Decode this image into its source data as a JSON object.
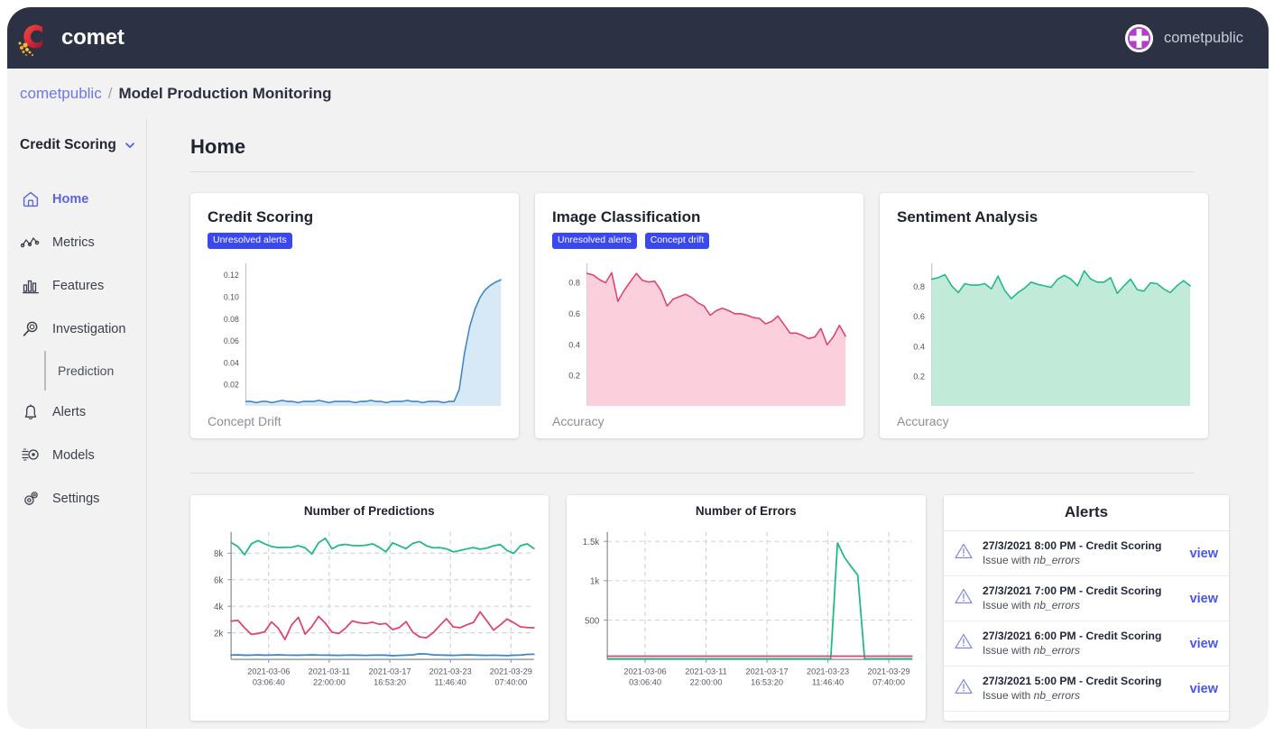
{
  "topbar": {
    "brand_name": "comet",
    "logo_icon": "comet-logo-icon",
    "user_name": "cometpublic",
    "avatar_icon": "user-avatar-icon"
  },
  "breadcrumb": {
    "workspace": "cometpublic",
    "separator": "/",
    "current": "Model Production Monitoring"
  },
  "sidebar": {
    "project": "Credit Scoring",
    "project_chevron": "chevron-down-icon",
    "items": [
      {
        "label": "Home",
        "icon": "home-icon",
        "active": true
      },
      {
        "label": "Metrics",
        "icon": "metrics-icon",
        "active": false
      },
      {
        "label": "Features",
        "icon": "features-bar-chart-icon",
        "active": false
      },
      {
        "label": "Investigation",
        "icon": "magnifier-icon",
        "active": false
      },
      {
        "label": "Alerts",
        "icon": "bell-icon",
        "active": false
      },
      {
        "label": "Models",
        "icon": "models-icon",
        "active": false
      },
      {
        "label": "Settings",
        "icon": "gear-icon",
        "active": false
      }
    ],
    "subitem": "Prediction"
  },
  "main": {
    "page_title": "Home"
  },
  "colors": {
    "badge_blue": "#3b48ee",
    "link_blue": "#4a55e8",
    "blue_line": "#3d85c6",
    "blue_fill": "#d7e8f7",
    "pink_line": "#e0436d",
    "pink_fill": "#fbd0dc",
    "green_line": "#1db98a",
    "green_fill": "#c2ead9",
    "topbar_bg": "#2c3244"
  },
  "cards": [
    {
      "title": "Credit Scoring",
      "badges": [
        "Unresolved alerts"
      ],
      "footer_label": "Concept Drift"
    },
    {
      "title": "Image Classification",
      "badges": [
        "Unresolved alerts",
        "Concept drift"
      ],
      "footer_label": "Accuracy"
    },
    {
      "title": "Sentiment Analysis",
      "badges": [],
      "footer_label": "Accuracy"
    }
  ],
  "panels": {
    "predictions_title": "Number of Predictions",
    "errors_title": "Number of Errors",
    "alerts_title": "Alerts"
  },
  "alerts": [
    {
      "title": "27/3/2021 8:00 PM - Credit Scoring",
      "sub_prefix": "Issue with ",
      "sub_metric": "nb_errors",
      "action": "view",
      "icon": "warning-triangle-icon"
    },
    {
      "title": "27/3/2021 7:00 PM - Credit Scoring",
      "sub_prefix": "Issue with ",
      "sub_metric": "nb_errors",
      "action": "view",
      "icon": "warning-triangle-icon"
    },
    {
      "title": "27/3/2021 6:00 PM - Credit Scoring",
      "sub_prefix": "Issue with ",
      "sub_metric": "nb_errors",
      "action": "view",
      "icon": "warning-triangle-icon"
    },
    {
      "title": "27/3/2021 5:00 PM - Credit Scoring",
      "sub_prefix": "Issue with ",
      "sub_metric": "nb_errors",
      "action": "view",
      "icon": "warning-triangle-icon"
    }
  ],
  "chart_data": [
    {
      "id": "credit_scoring_drift",
      "type": "area",
      "title": "Credit Scoring",
      "ylabel": "Concept Drift",
      "xlabel": "",
      "grid": false,
      "ylim": [
        0,
        0.13
      ],
      "yticks": [
        0.02,
        0.04,
        0.06,
        0.08,
        0.1,
        0.12
      ],
      "ytick_labels": [
        "0.02",
        "0.04",
        "0.06",
        "0.08",
        "0.10",
        "0.12"
      ],
      "series": [
        {
          "name": "Concept Drift",
          "color": "#3d85c6",
          "fill": "#d7e8f7",
          "values": [
            0.004,
            0.004,
            0.003,
            0.004,
            0.004,
            0.003,
            0.004,
            0.005,
            0.004,
            0.004,
            0.003,
            0.004,
            0.004,
            0.004,
            0.005,
            0.004,
            0.003,
            0.004,
            0.004,
            0.004,
            0.004,
            0.003,
            0.004,
            0.004,
            0.005,
            0.004,
            0.004,
            0.003,
            0.004,
            0.004,
            0.004,
            0.005,
            0.004,
            0.004,
            0.003,
            0.004,
            0.004,
            0.004,
            0.003,
            0.004,
            0.004,
            0.015,
            0.048,
            0.072,
            0.088,
            0.099,
            0.106,
            0.11,
            0.113,
            0.115
          ]
        }
      ]
    },
    {
      "id": "image_classification_accuracy",
      "type": "area",
      "title": "Image Classification",
      "ylabel": "Accuracy",
      "xlabel": "",
      "grid": false,
      "ylim": [
        0,
        0.92
      ],
      "yticks": [
        0.2,
        0.4,
        0.6,
        0.8
      ],
      "ytick_labels": [
        "0.2",
        "0.4",
        "0.6",
        "0.8"
      ],
      "series": [
        {
          "name": "Accuracy",
          "color": "#e0436d",
          "fill": "#fbd0dc",
          "values": [
            0.855,
            0.845,
            0.815,
            0.795,
            0.86,
            0.675,
            0.745,
            0.8,
            0.855,
            0.81,
            0.8,
            0.805,
            0.745,
            0.645,
            0.69,
            0.705,
            0.72,
            0.7,
            0.665,
            0.645,
            0.585,
            0.615,
            0.63,
            0.615,
            0.595,
            0.595,
            0.585,
            0.57,
            0.565,
            0.53,
            0.545,
            0.58,
            0.525,
            0.47,
            0.47,
            0.455,
            0.435,
            0.445,
            0.5,
            0.395,
            0.445,
            0.52,
            0.45
          ]
        }
      ]
    },
    {
      "id": "sentiment_analysis_accuracy",
      "type": "area",
      "title": "Sentiment Analysis",
      "ylabel": "Accuracy",
      "xlabel": "",
      "grid": false,
      "ylim": [
        0,
        0.95
      ],
      "yticks": [
        0.2,
        0.4,
        0.6,
        0.8
      ],
      "ytick_labels": [
        "0.2",
        "0.4",
        "0.6",
        "0.8"
      ],
      "series": [
        {
          "name": "Accuracy",
          "color": "#1db98a",
          "fill": "#c2ead9",
          "values": [
            0.845,
            0.855,
            0.875,
            0.8,
            0.755,
            0.815,
            0.805,
            0.805,
            0.815,
            0.78,
            0.865,
            0.77,
            0.715,
            0.755,
            0.785,
            0.825,
            0.81,
            0.8,
            0.79,
            0.845,
            0.87,
            0.845,
            0.8,
            0.9,
            0.845,
            0.825,
            0.825,
            0.855,
            0.75,
            0.8,
            0.845,
            0.775,
            0.765,
            0.82,
            0.815,
            0.78,
            0.755,
            0.8,
            0.835,
            0.8
          ]
        }
      ]
    },
    {
      "id": "number_of_predictions",
      "type": "line",
      "title": "Number of Predictions",
      "xlabel": "",
      "ylabel": "",
      "grid": true,
      "ylim": [
        0,
        9600
      ],
      "yticks": [
        2000,
        4000,
        6000,
        8000
      ],
      "ytick_labels": [
        "2k",
        "4k",
        "6k",
        "8k"
      ],
      "xtick_labels": [
        "2021-03-06\n03:06:40",
        "2021-03-11\n22:00:00",
        "2021-03-17\n16:53:20",
        "2021-03-23\n11:46:40",
        "2021-03-29\n07:40:00"
      ],
      "series": [
        {
          "name": "green",
          "color": "#1db98a",
          "values": [
            8800,
            8500,
            7880,
            8700,
            8950,
            8700,
            8500,
            8420,
            8430,
            8450,
            8560,
            8400,
            7930,
            8780,
            9120,
            8330,
            8600,
            8660,
            8580,
            8560,
            8600,
            8700,
            8450,
            8100,
            8780,
            8560,
            8340,
            8740,
            8870,
            8560,
            8400,
            8420,
            8330,
            8100,
            8200,
            8320,
            8420,
            8300,
            8380,
            8560,
            8650,
            8200,
            7980,
            8560,
            8700,
            8350
          ]
        },
        {
          "name": "pink",
          "color": "#e0436d",
          "values": [
            2880,
            2940,
            2380,
            1880,
            1950,
            2080,
            2820,
            2350,
            1500,
            2600,
            3170,
            1900,
            2470,
            3240,
            2730,
            2050,
            1950,
            2350,
            2900,
            2760,
            2700,
            2800,
            2650,
            2700,
            2250,
            2400,
            2840,
            2050,
            1700,
            1620,
            2000,
            2550,
            3060,
            2450,
            2380,
            2600,
            2780,
            3580,
            2900,
            2200,
            2600,
            3040,
            2760,
            2450,
            2400,
            2380
          ]
        },
        {
          "name": "blue",
          "color": "#3d85c6",
          "values": [
            330,
            350,
            310,
            320,
            340,
            310,
            330,
            350,
            330,
            320,
            310,
            330,
            350,
            330,
            320,
            310,
            300,
            320,
            330,
            310,
            300,
            320,
            330,
            310,
            280,
            300,
            320,
            340,
            420,
            400,
            350,
            330,
            310,
            300,
            320,
            340,
            330,
            310,
            300,
            320,
            300,
            290,
            310,
            330,
            380,
            390
          ]
        }
      ]
    },
    {
      "id": "number_of_errors",
      "type": "line",
      "title": "Number of Errors",
      "xlabel": "",
      "ylabel": "",
      "grid": true,
      "ylim": [
        0,
        1620
      ],
      "yticks": [
        500,
        1000,
        1500
      ],
      "ytick_labels": [
        "500",
        "1k",
        "1.5k"
      ],
      "xtick_labels": [
        "2021-03-06\n03:06:40",
        "2021-03-11\n22:00:00",
        "2021-03-17\n16:53:20",
        "2021-03-23\n11:46:40",
        "2021-03-29\n07:40:00"
      ],
      "series": [
        {
          "name": "green",
          "color": "#1db98a",
          "values": [
            8,
            8,
            8,
            8,
            8,
            8,
            8,
            8,
            8,
            8,
            8,
            8,
            8,
            8,
            8,
            8,
            8,
            8,
            8,
            8,
            8,
            8,
            8,
            8,
            8,
            8,
            8,
            8,
            8,
            8,
            8,
            8,
            8,
            8,
            1480,
            1300,
            1180,
            1070,
            8,
            8,
            8,
            8,
            8,
            8,
            8,
            8
          ]
        },
        {
          "name": "pink",
          "color": "#e0436d",
          "values": [
            40,
            40,
            40,
            40,
            40,
            40,
            40,
            40,
            40,
            40,
            40,
            40,
            40,
            40,
            40,
            40,
            40,
            40,
            40,
            40,
            40,
            40,
            40,
            40,
            40,
            40,
            40,
            40,
            40,
            40,
            40,
            40,
            40,
            40,
            40,
            40,
            40,
            40,
            40,
            40,
            40,
            40,
            40,
            40,
            40,
            40
          ]
        }
      ]
    }
  ]
}
